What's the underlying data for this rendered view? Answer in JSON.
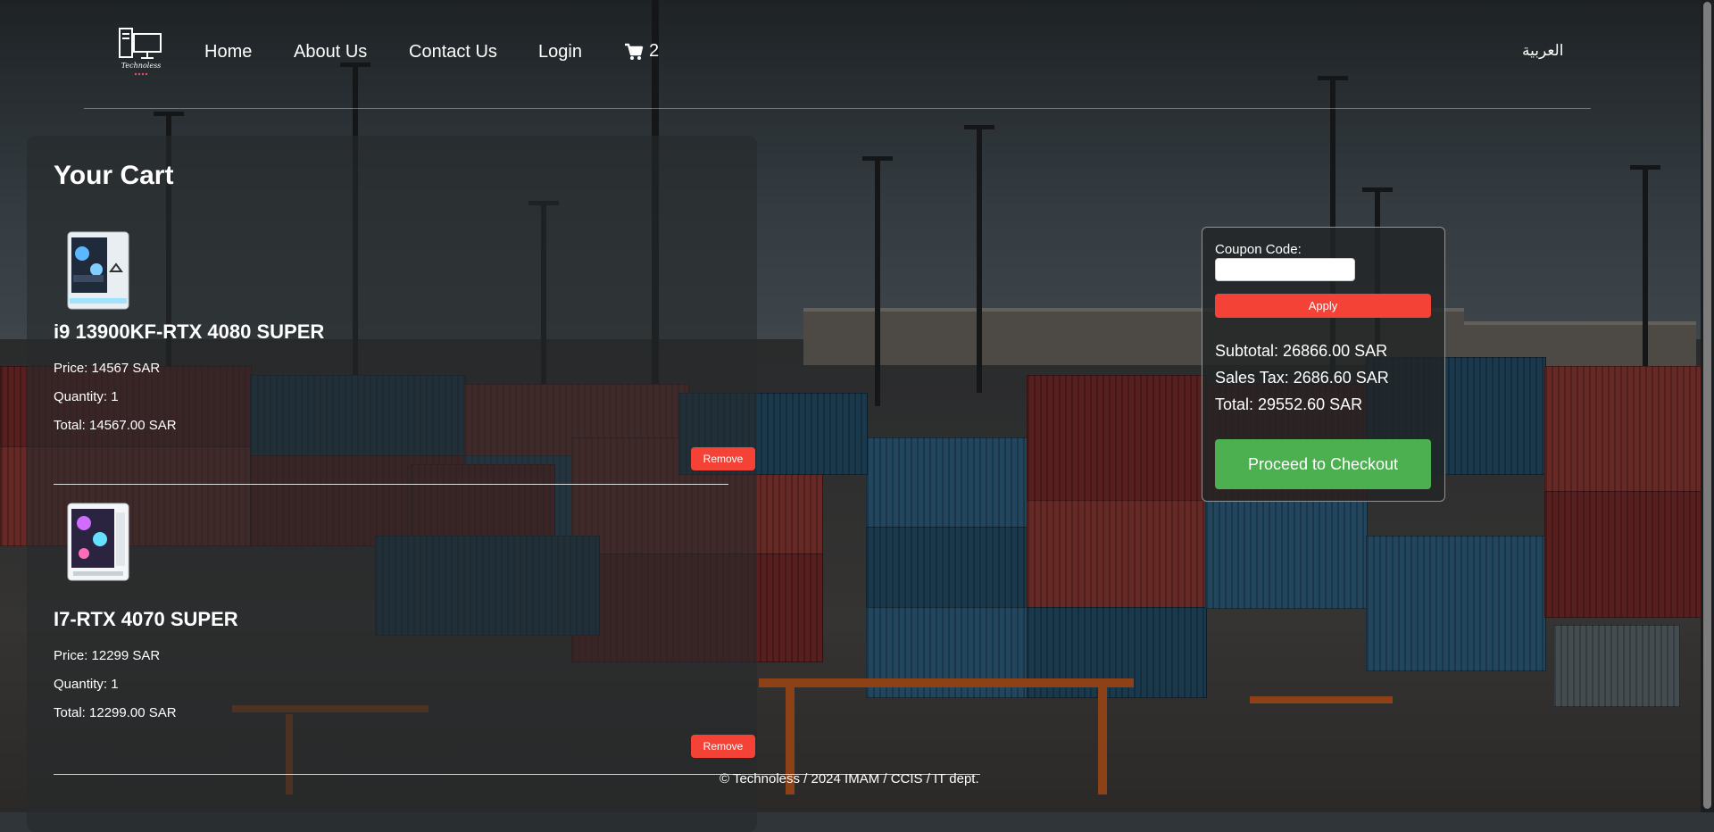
{
  "nav": {
    "logo_alt": "Technoless",
    "links": [
      "Home",
      "About Us",
      "Contact Us",
      "Login"
    ],
    "cart_count": "2",
    "language": "العربية"
  },
  "cart": {
    "title": "Your Cart",
    "items": [
      {
        "name": "i9 13900KF-RTX 4080 SUPER",
        "price": "Price: 14567 SAR",
        "quantity": "Quantity: 1",
        "total": "Total: 14567.00 SAR",
        "remove_label": "Remove"
      },
      {
        "name": "I7-RTX 4070 SUPER",
        "price": "Price: 12299 SAR",
        "quantity": "Quantity: 1",
        "total": "Total: 12299.00 SAR",
        "remove_label": "Remove"
      }
    ]
  },
  "summary": {
    "coupon_label": "Coupon Code:",
    "coupon_value": "",
    "apply_label": "Apply",
    "subtotal": "Subtotal: 26866.00 SAR",
    "sales_tax": "Sales Tax: 2686.60 SAR",
    "total": "Total: 29552.60 SAR",
    "checkout_label": "Proceed to Checkout"
  },
  "footer": {
    "text": "© Technoless / 2024 IMAM / CCIS / IT dept."
  },
  "colors": {
    "remove": "#f44336",
    "apply": "#f44336",
    "checkout": "#4caf50"
  }
}
